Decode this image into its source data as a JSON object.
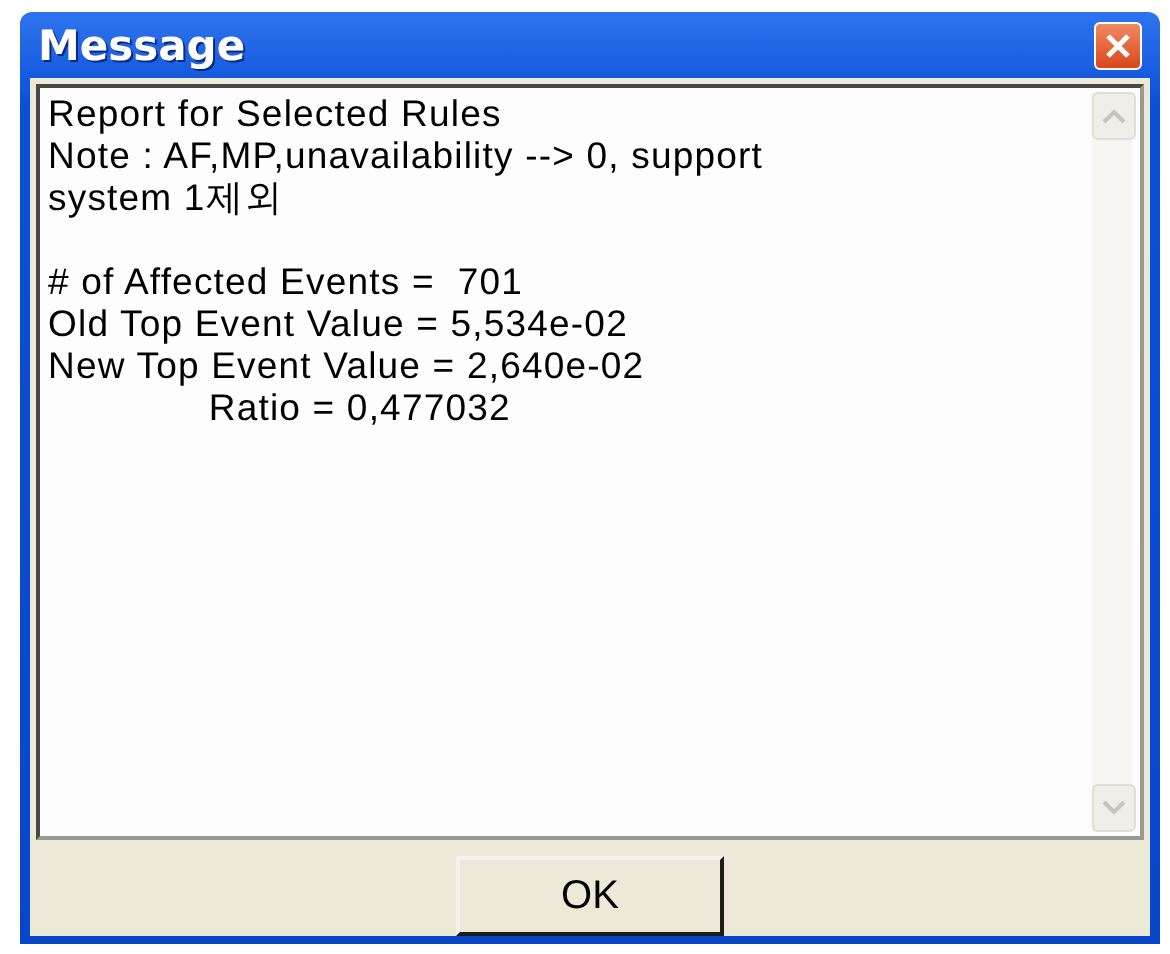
{
  "window": {
    "title": "Message"
  },
  "message": {
    "text": "Report for Selected Rules\nNote : AF,MP,unavailability --> 0, support\nsystem 1제외\n\n# of Affected Events =  701\nOld Top Event Value = 5,534e-02\nNew Top Event Value = 2,640e-02\n              Ratio = 0,477032"
  },
  "buttons": [
    {
      "label": "OK"
    }
  ]
}
